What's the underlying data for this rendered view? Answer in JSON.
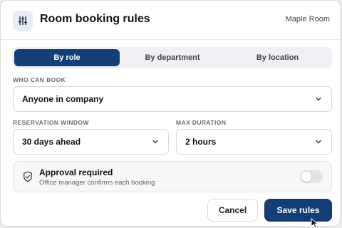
{
  "header": {
    "title": "Room booking rules",
    "room": "Maple Room",
    "icon": "sliders-icon"
  },
  "tabs": [
    {
      "label": "By role",
      "active": true
    },
    {
      "label": "By department",
      "active": false
    },
    {
      "label": "By location",
      "active": false
    }
  ],
  "who_can_book": {
    "label": "WHO CAN BOOK",
    "value": "Anyone in company"
  },
  "reservation_window": {
    "label": "RESERVATION WINDOW",
    "value": "30 days ahead"
  },
  "max_duration": {
    "label": "MAX DURATION",
    "value": "2 hours"
  },
  "approval": {
    "title": "Approval required",
    "subtitle": "Office manager confirms each booking",
    "enabled": false
  },
  "actions": {
    "cancel": "Cancel",
    "save": "Save rules"
  },
  "colors": {
    "accent": "#133e78"
  }
}
